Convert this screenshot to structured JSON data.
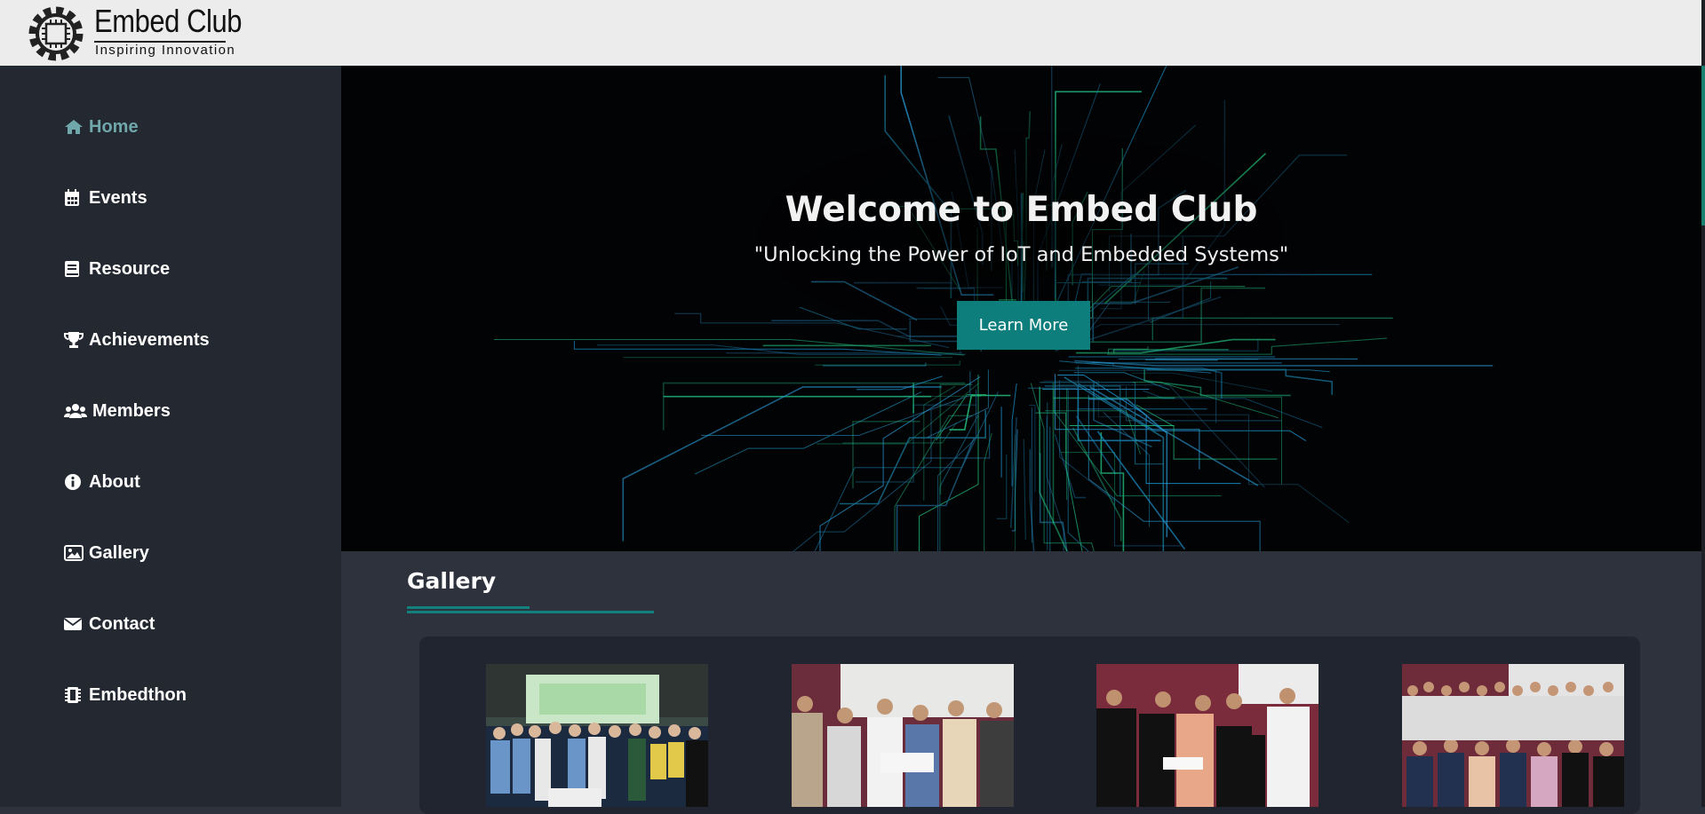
{
  "header": {
    "logo_title": "Embed Club",
    "logo_subtitle": "Inspiring Innovation",
    "logo_icon": "chip-gear-logo"
  },
  "sidebar": {
    "items": [
      {
        "label": "Home",
        "icon": "home-icon",
        "active": true
      },
      {
        "label": "Events",
        "icon": "calendar-icon",
        "active": false
      },
      {
        "label": "Resource",
        "icon": "book-icon",
        "active": false
      },
      {
        "label": "Achievements",
        "icon": "trophy-icon",
        "active": false
      },
      {
        "label": "Members",
        "icon": "users-icon",
        "active": false
      },
      {
        "label": "About",
        "icon": "info-icon",
        "active": false
      },
      {
        "label": "Gallery",
        "icon": "image-icon",
        "active": false
      },
      {
        "label": "Contact",
        "icon": "envelope-icon",
        "active": false
      },
      {
        "label": "Embedthon",
        "icon": "microchip-icon",
        "active": false
      }
    ]
  },
  "hero": {
    "title": "Welcome to Embed Club",
    "subtitle": "\"Unlocking the Power of IoT and Embedded Systems\"",
    "button_label": "Learn More"
  },
  "gallery": {
    "title": "Gallery",
    "photos": [
      "gallery-photo-1",
      "gallery-photo-2",
      "gallery-photo-3",
      "gallery-photo-4"
    ]
  },
  "colors": {
    "accent": "#0e7e7c",
    "sidebar_bg": "#232831",
    "content_bg": "#2e323d",
    "active_nav": "#6fa7aa",
    "hero_bg": "#020305"
  }
}
